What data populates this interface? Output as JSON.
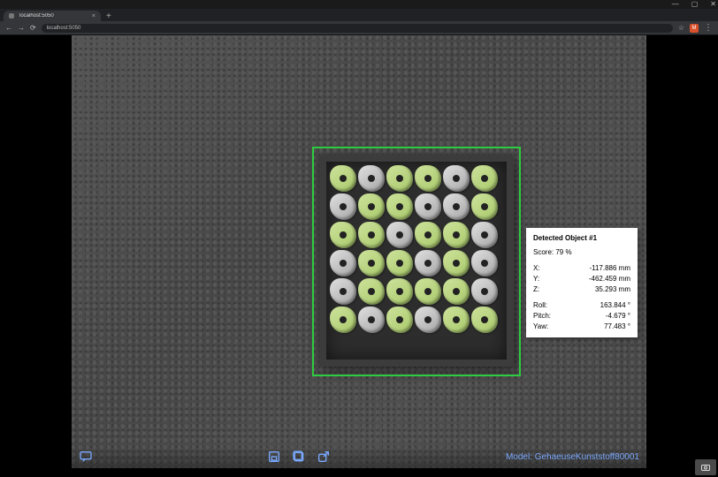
{
  "browser": {
    "tab_title": "localhost:5050",
    "url": "localhost:5050",
    "avatar_letter": "M"
  },
  "detection": {
    "header": "Detected Object #1",
    "score_label": "Score: 79 %",
    "rows": [
      {
        "k": "X:",
        "v": "-117.886 mm"
      },
      {
        "k": "Y:",
        "v": "-462.459 mm"
      },
      {
        "k": "Z:",
        "v": "35.293 mm"
      }
    ],
    "rows2": [
      {
        "k": "Roll:",
        "v": "163.844 °"
      },
      {
        "k": "Pitch:",
        "v": "-4.679 °"
      },
      {
        "k": "Yaw:",
        "v": "77.483 °"
      }
    ]
  },
  "footer": {
    "model_label": "Model: GehaeuseKunststoff80001"
  },
  "colors": {
    "accent": "#7aa9ff",
    "detect_box": "#2ecc40"
  }
}
